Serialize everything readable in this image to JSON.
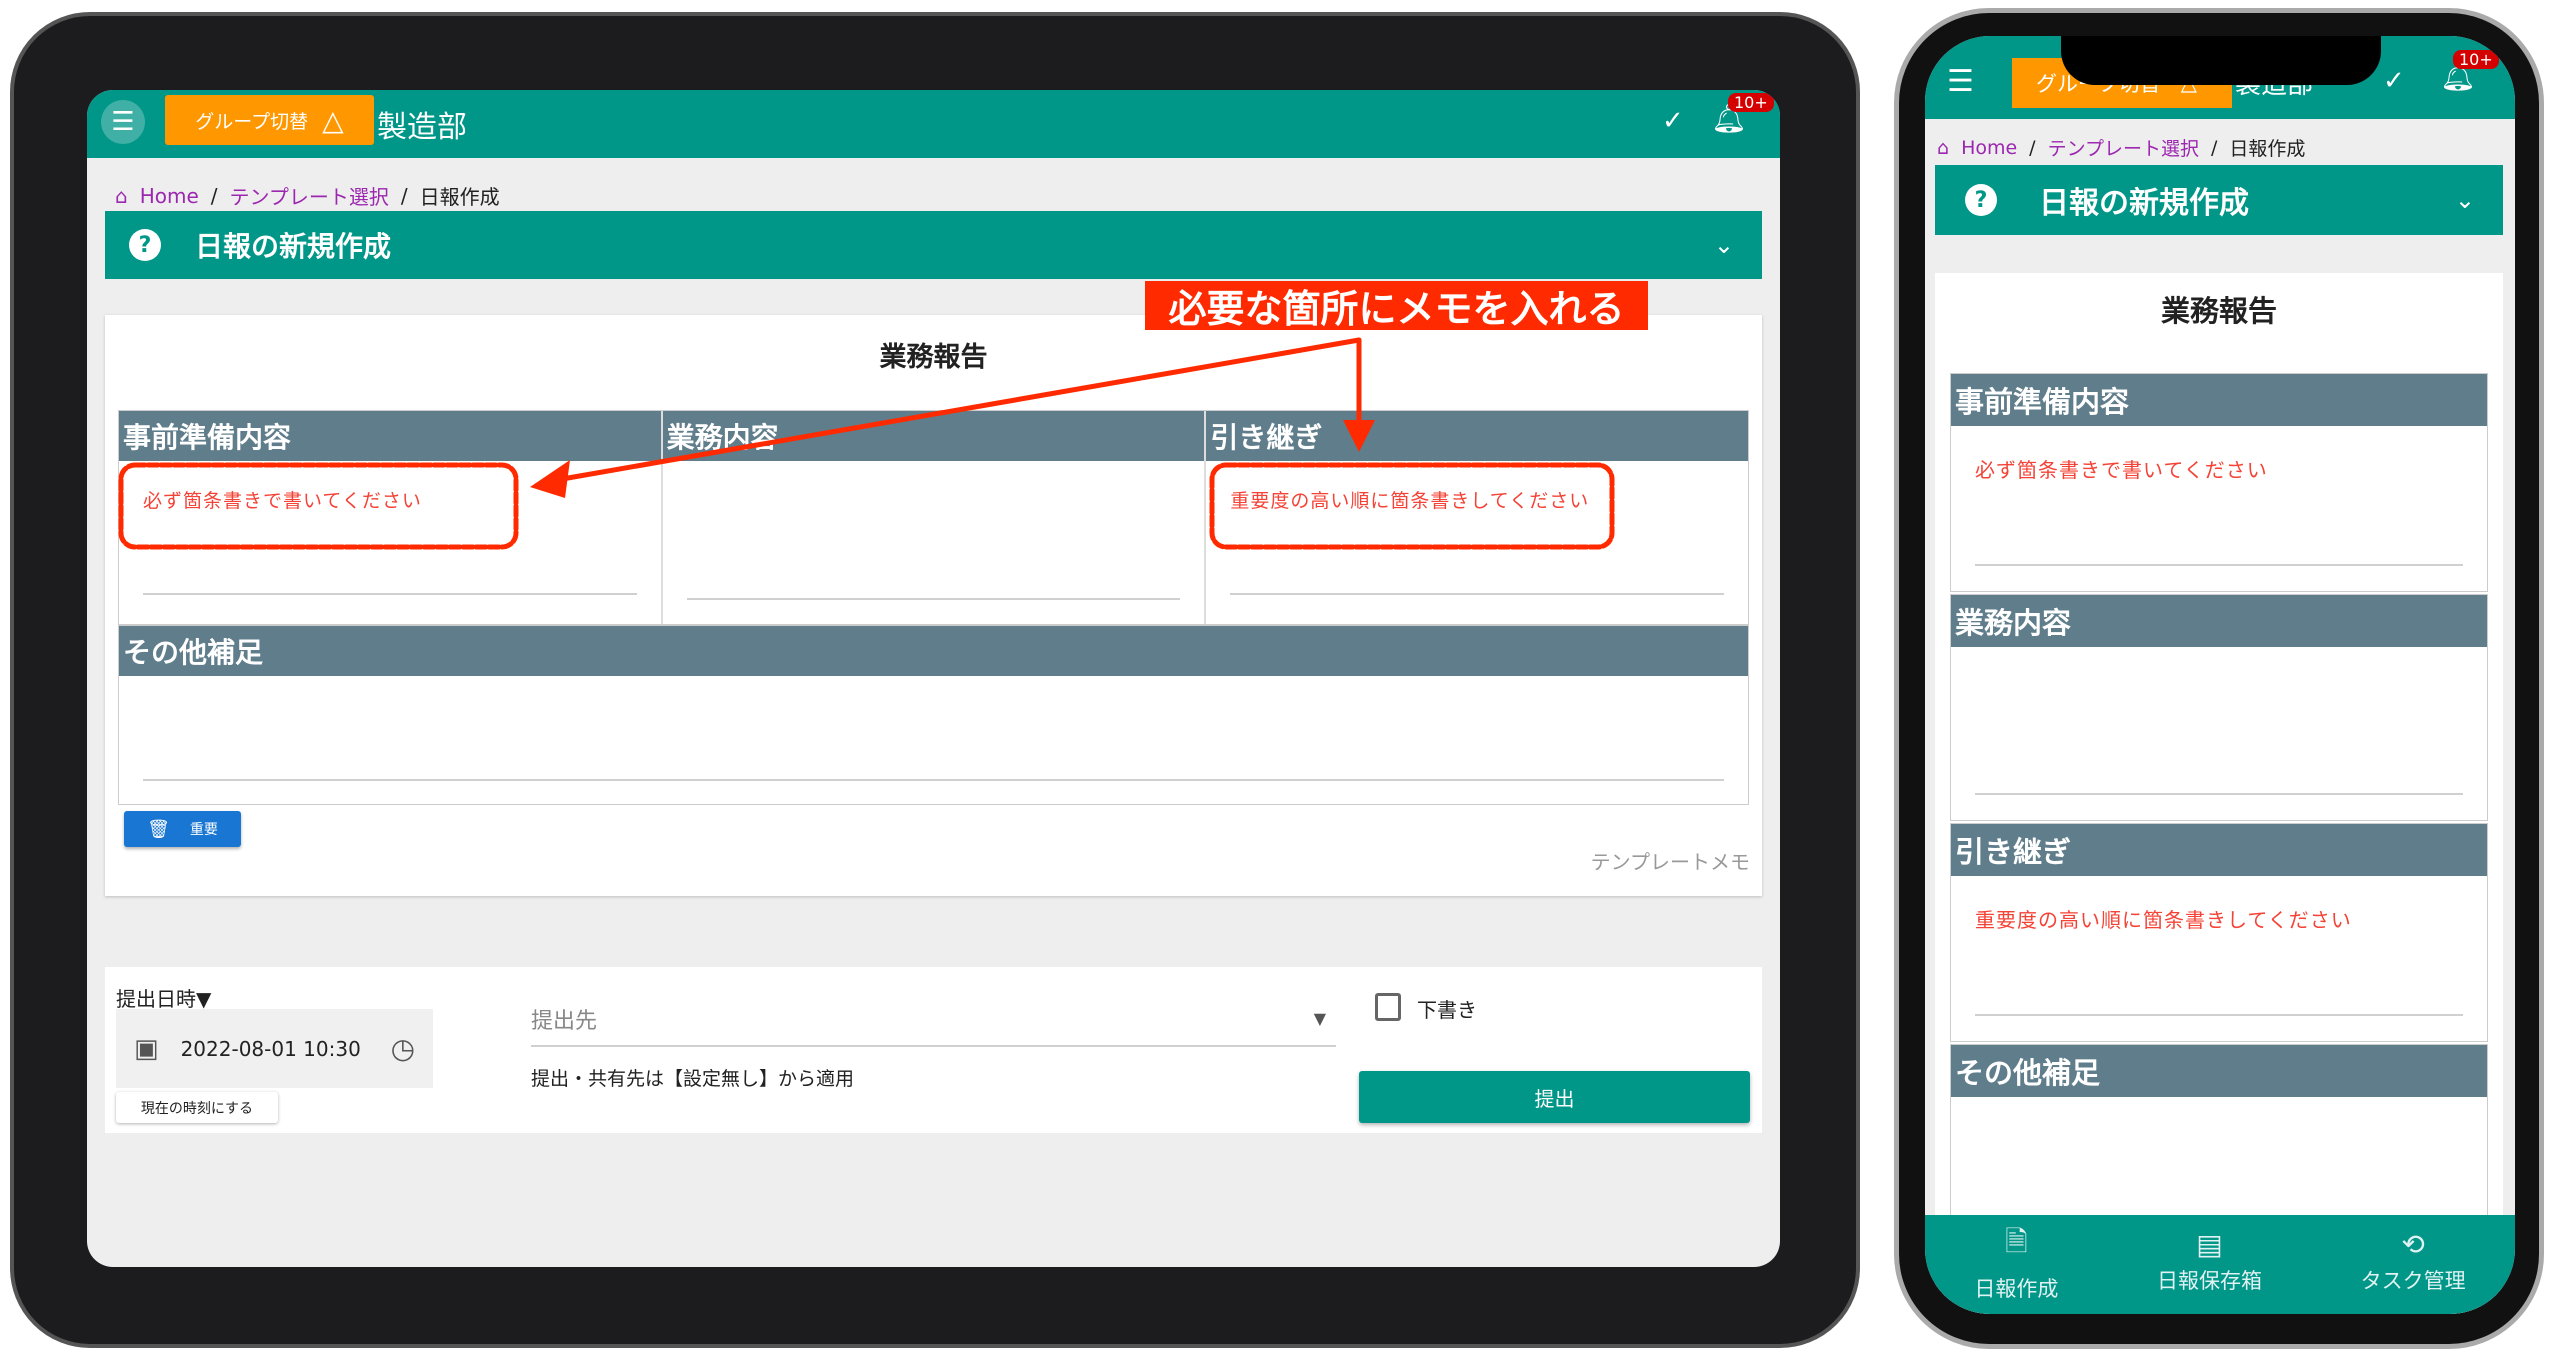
{
  "colors": {
    "primary": "#009688",
    "accent": "#ff9800",
    "section_header": "#607d8b",
    "placeholder": "#f44336",
    "annotation": "#ff2a00",
    "link": "#9c27b0",
    "important_button": "#1976d2"
  },
  "appbar": {
    "menu_icon": "hamburger-icon",
    "group_switch_label": "グループ切替",
    "group_switch_icon": "warning-triangle-icon",
    "group_name": "製造部",
    "check_icon": "check-icon",
    "bell_icon": "bell-icon",
    "badge": "10+"
  },
  "breadcrumb": {
    "home": "Home",
    "template": "テンプレート選択",
    "current": "日報作成",
    "separator": "/"
  },
  "page_title": {
    "icon": "help-circle-icon",
    "label": "日報の新規作成",
    "chevron": "chevron-down-icon"
  },
  "annotation": {
    "label": "必要な箇所にメモを入れる"
  },
  "report": {
    "title": "業務報告",
    "sections": [
      {
        "header": "事前準備内容",
        "placeholder": "必ず箇条書きで書いてください"
      },
      {
        "header": "業務内容",
        "placeholder": ""
      },
      {
        "header": "引き継ぎ",
        "placeholder": "重要度の高い順に箇条書きしてください"
      },
      {
        "header": "その他補足",
        "placeholder": ""
      }
    ],
    "important_button": "重要",
    "template_memo": "テンプレートメモ"
  },
  "submit": {
    "datetime_label": "提出日時▼",
    "datetime_value": "2022-08-01 10:30",
    "now_button": "現在の時刻にする",
    "destination_placeholder": "提出先",
    "destination_note": "提出・共有先は【設定無し】から適用",
    "draft_label": "下書き",
    "draft_checked": false,
    "submit_button": "提出"
  },
  "bottom_nav": [
    {
      "label": "日報作成",
      "icon": "file-plus-icon"
    },
    {
      "label": "日報保存箱",
      "icon": "archive-icon"
    },
    {
      "label": "タスク管理",
      "icon": "task-refresh-icon"
    }
  ]
}
